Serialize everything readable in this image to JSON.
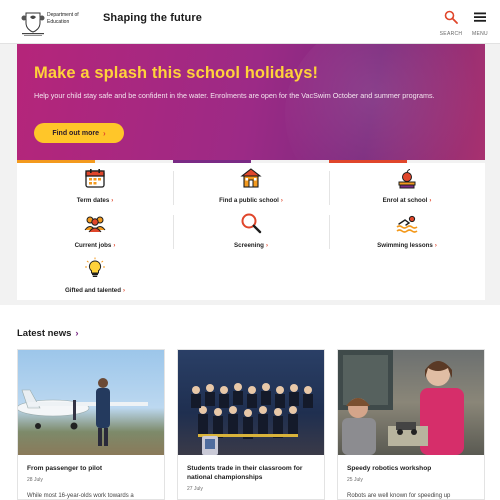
{
  "header": {
    "dept_name": "Department of Education",
    "tagline": "Shaping the future",
    "search_label": "SEARCH",
    "menu_label": "MENU",
    "icons": {
      "search": "search-icon",
      "menu": "hamburger-icon",
      "crest": "government-crest-icon"
    }
  },
  "hero": {
    "title": "Make a splash this school holidays!",
    "text": "Help your child stay safe and be confident in the water. Enrolments are open for the VacSwim October and summer programs.",
    "button_label": "Find out more",
    "colors": {
      "background": "#9c2a86",
      "title": "#ffd23a",
      "button": "#ffc629"
    }
  },
  "quick_links": [
    {
      "label": "Term dates",
      "icon": "calendar-icon"
    },
    {
      "label": "Find a public school",
      "icon": "school-building-icon"
    },
    {
      "label": "Enrol at school",
      "icon": "apple-books-icon"
    },
    {
      "label": "Current jobs",
      "icon": "people-group-icon"
    },
    {
      "label": "Screening",
      "icon": "magnifier-icon"
    },
    {
      "label": "Swimming lessons",
      "icon": "swimmer-icon"
    },
    {
      "label": "Gifted and talented",
      "icon": "lightbulb-icon"
    }
  ],
  "stripe_colors": [
    "#f39a1e",
    "#f39a1e",
    "#7a2a85",
    "#7a2a85",
    "#e0462b",
    "#e0462b"
  ],
  "news": {
    "heading": "Latest news",
    "cards": [
      {
        "title": "From passenger to pilot",
        "date": "28 July",
        "excerpt": "While most 16-year-olds work towards a"
      },
      {
        "title": "Students trade in their classroom for national championships",
        "date": "27 July",
        "excerpt": ""
      },
      {
        "title": "Speedy robotics workshop",
        "date": "25 July",
        "excerpt": "Robots are well known for speeding up"
      }
    ]
  }
}
